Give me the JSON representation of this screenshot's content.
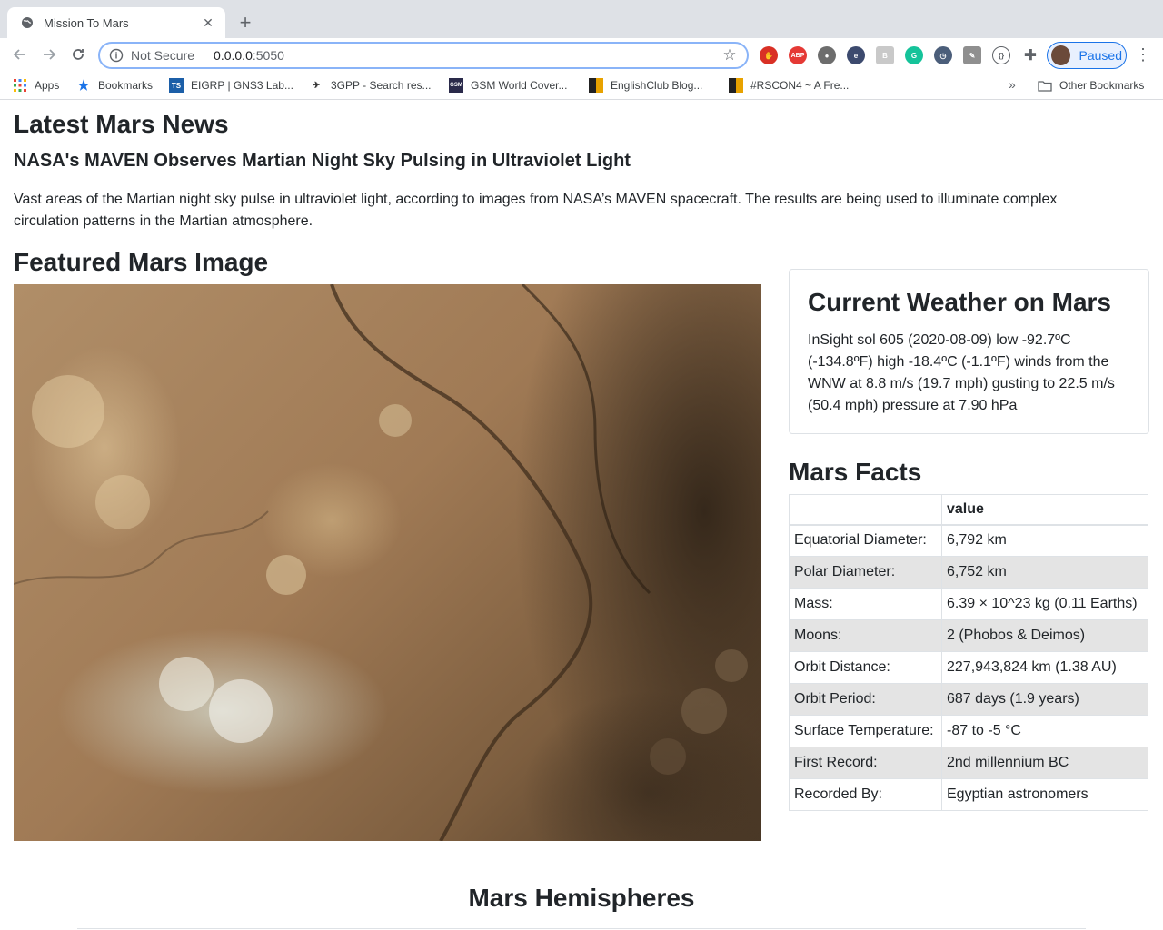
{
  "browser": {
    "tab_title": "Mission To Mars",
    "security_label": "Not Secure",
    "url_host": "0.0.0.0",
    "url_port": ":5050",
    "profile_label": "Paused",
    "bookmarks": [
      {
        "label": "Apps",
        "icon": "apps-grid-icon"
      },
      {
        "label": "Bookmarks",
        "icon": "star-icon"
      },
      {
        "label": "EIGRP | GNS3 Lab...",
        "icon": "ts-icon"
      },
      {
        "label": "3GPP - Search res...",
        "icon": "3gpp-icon"
      },
      {
        "label": "GSM World Cover...",
        "icon": "gsm-icon"
      },
      {
        "label": "EnglishClub Blog...",
        "icon": "blog-icon"
      },
      {
        "label": "#RSCON4 ~ A Fre...",
        "icon": "rscon-icon"
      }
    ],
    "other_bookmarks": "Other Bookmarks",
    "ext_abp": "ABP"
  },
  "news": {
    "heading": "Latest Mars News",
    "title": "NASA's MAVEN Observes Martian Night Sky Pulsing in Ultraviolet Light",
    "paragraph": "Vast areas of the Martian night sky pulse in ultraviolet light, according to images from NASA’s MAVEN spacecraft. The results are being used to illuminate complex circulation patterns in the Martian atmosphere."
  },
  "featured": {
    "heading": "Featured Mars Image"
  },
  "weather": {
    "heading": "Current Weather on Mars",
    "text": "InSight sol 605 (2020-08-09) low -92.7ºC (-134.8ºF) high -18.4ºC (-1.1ºF) winds from the WNW at 8.8 m/s (19.7 mph) gusting to 22.5 m/s (50.4 mph) pressure at 7.90 hPa"
  },
  "facts": {
    "heading": "Mars Facts",
    "col_header_1": "",
    "col_header_2": "value",
    "rows": [
      {
        "label": "Equatorial Diameter:",
        "value": "6,792 km"
      },
      {
        "label": "Polar Diameter:",
        "value": "6,752 km"
      },
      {
        "label": "Mass:",
        "value": "6.39 × 10^23 kg (0.11 Earths)"
      },
      {
        "label": "Moons:",
        "value": "2 (Phobos & Deimos)"
      },
      {
        "label": "Orbit Distance:",
        "value": "227,943,824 km (1.38 AU)"
      },
      {
        "label": "Orbit Period:",
        "value": "687 days (1.9 years)"
      },
      {
        "label": "Surface Temperature:",
        "value": "-87 to -5 °C"
      },
      {
        "label": "First Record:",
        "value": "2nd millennium BC"
      },
      {
        "label": "Recorded By:",
        "value": "Egyptian astronomers"
      }
    ]
  },
  "hemispheres": {
    "heading": "Mars Hemispheres"
  },
  "colors": {
    "tabstrip": "#dee1e6",
    "omnibox_focus": "#8ab4f8",
    "profile_accent": "#1a73e8",
    "table_stripe": "#e4e4e4"
  }
}
